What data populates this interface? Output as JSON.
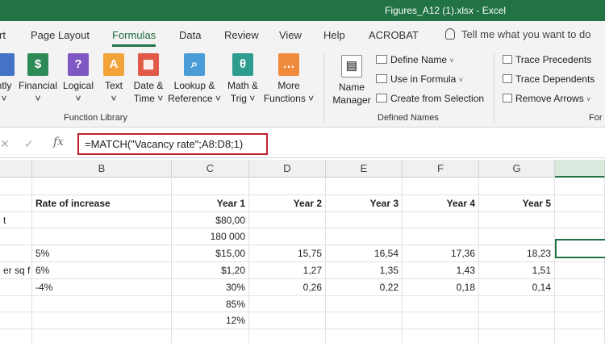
{
  "window": {
    "title": "Figures_A12 (1).xlsx  -  Excel"
  },
  "tabs": [
    "rt",
    "Page Layout",
    "Formulas",
    "Data",
    "Review",
    "View",
    "Help",
    "ACROBAT"
  ],
  "active_tab": "Formulas",
  "tell_me": "Tell me what you want to do",
  "ribbon": {
    "function_library": {
      "label": "Function Library",
      "buttons": [
        {
          "label": "ntly\n˅",
          "icon": "recently-used-icon",
          "color": "#4472c4"
        },
        {
          "label": "Financial\n˅",
          "icon": "financial-icon",
          "color": "#2e8b57"
        },
        {
          "label": "Logical\n˅",
          "icon": "logical-icon",
          "color": "#7e57c2",
          "glyph": "?"
        },
        {
          "label": "Text\n˅",
          "icon": "text-icon",
          "color": "#f2a33a",
          "glyph": "A"
        },
        {
          "label": "Date &\nTime ˅",
          "icon": "date-time-icon",
          "color": "#e05a47"
        },
        {
          "label": "Lookup &\nReference ˅",
          "icon": "lookup-icon",
          "color": "#4a9bd6"
        },
        {
          "label": "Math &\nTrig ˅",
          "icon": "math-trig-icon",
          "color": "#2e9c8f",
          "glyph": "θ"
        },
        {
          "label": "More\nFunctions ˅",
          "icon": "more-functions-icon",
          "color": "#f08a3c",
          "glyph": "…"
        }
      ]
    },
    "defined_names": {
      "label": "Defined Names",
      "name_manager": "Name\nManager",
      "define_name": "Define Name",
      "use_in_formula": "Use in Formula",
      "create_from_selection": "Create from Selection"
    },
    "formula_auditing": {
      "label": "For",
      "trace_precedents": "Trace Precedents",
      "trace_dependents": "Trace Dependents",
      "remove_arrows": "Remove Arrows"
    }
  },
  "formula_bar": {
    "cancel": "✕",
    "enter": "✓",
    "fx": "fx",
    "formula": "=MATCH(\"Vacancy rate\";A8:D8;1)"
  },
  "columns": [
    "B",
    "C",
    "D",
    "E",
    "F",
    "G",
    ""
  ],
  "rows": [
    [
      "",
      "",
      "",
      "",
      "",
      "",
      "",
      ""
    ],
    [
      "",
      "Rate of increase",
      "Year 1",
      "Year 2",
      "Year 3",
      "Year 4",
      "Year 5",
      ""
    ],
    [
      "t",
      "",
      "$80,00",
      "",
      "",
      "",
      "",
      ""
    ],
    [
      "",
      "",
      "180 000",
      "",
      "",
      "",
      "",
      ""
    ],
    [
      "",
      "5%",
      "$15,00",
      "15,75",
      "16,54",
      "17,36",
      "18,23",
      ""
    ],
    [
      "er sq f",
      "6%",
      "$1,20",
      "1,27",
      "1,35",
      "1,43",
      "1,51",
      ""
    ],
    [
      "",
      "-4%",
      "30%",
      "0,26",
      "0,22",
      "0,18",
      "0,14",
      ""
    ],
    [
      "",
      "",
      "85%",
      "",
      "",
      "",
      "",
      ""
    ],
    [
      "",
      "",
      "12%",
      "",
      "",
      "",
      "",
      ""
    ],
    [
      "",
      "",
      "",
      "",
      "",
      "",
      "",
      ""
    ]
  ]
}
